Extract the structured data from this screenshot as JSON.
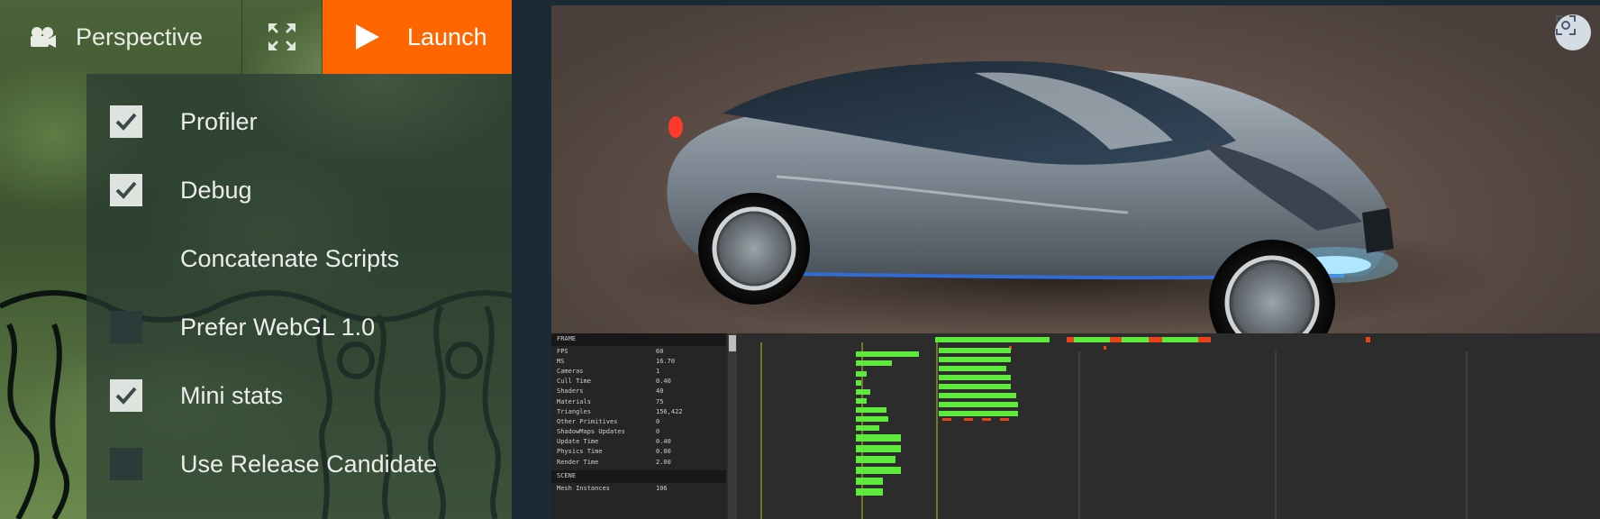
{
  "toolbar": {
    "camera_label": "Perspective",
    "launch_label": "Launch",
    "camera_icon": "camera-icon",
    "expand_icon": "expand-icon",
    "launch_icon": "play-icon"
  },
  "launch_menu": {
    "items": [
      {
        "label": "Profiler",
        "checked": true
      },
      {
        "label": "Debug",
        "checked": true
      },
      {
        "label": "Concatenate Scripts",
        "checked": null
      },
      {
        "label": "Prefer WebGL 1.0",
        "checked": false
      },
      {
        "label": "Mini stats",
        "checked": true
      },
      {
        "label": "Use Release Candidate",
        "checked": false
      }
    ]
  },
  "viewport": {
    "screenshot_icon": "screenshot-icon"
  },
  "profiler": {
    "header": "FRAME",
    "stats": [
      {
        "key": "FPS",
        "value": "60"
      },
      {
        "key": "MS",
        "value": "16.70"
      },
      {
        "key": "Cameras",
        "value": "1"
      },
      {
        "key": "Cull Time",
        "value": "0.40"
      },
      {
        "key": "Shaders",
        "value": "40"
      },
      {
        "key": "Materials",
        "value": "75"
      },
      {
        "key": "Triangles",
        "value": "156,422"
      },
      {
        "key": "Other Primitives",
        "value": "0"
      },
      {
        "key": "ShadowMaps Updates",
        "value": "0"
      },
      {
        "key": "Update Time",
        "value": "0.40"
      },
      {
        "key": "Physics Time",
        "value": "0.00"
      },
      {
        "key": "Render Time",
        "value": "2.00"
      }
    ],
    "section2": "SCENE",
    "stats2": [
      {
        "key": "Mesh Instances",
        "value": "106"
      }
    ]
  },
  "colors": {
    "accent": "#ff6600",
    "graph_green": "#5dea3c",
    "graph_red": "#e8431a",
    "graph_marker": "#c8b83a"
  }
}
